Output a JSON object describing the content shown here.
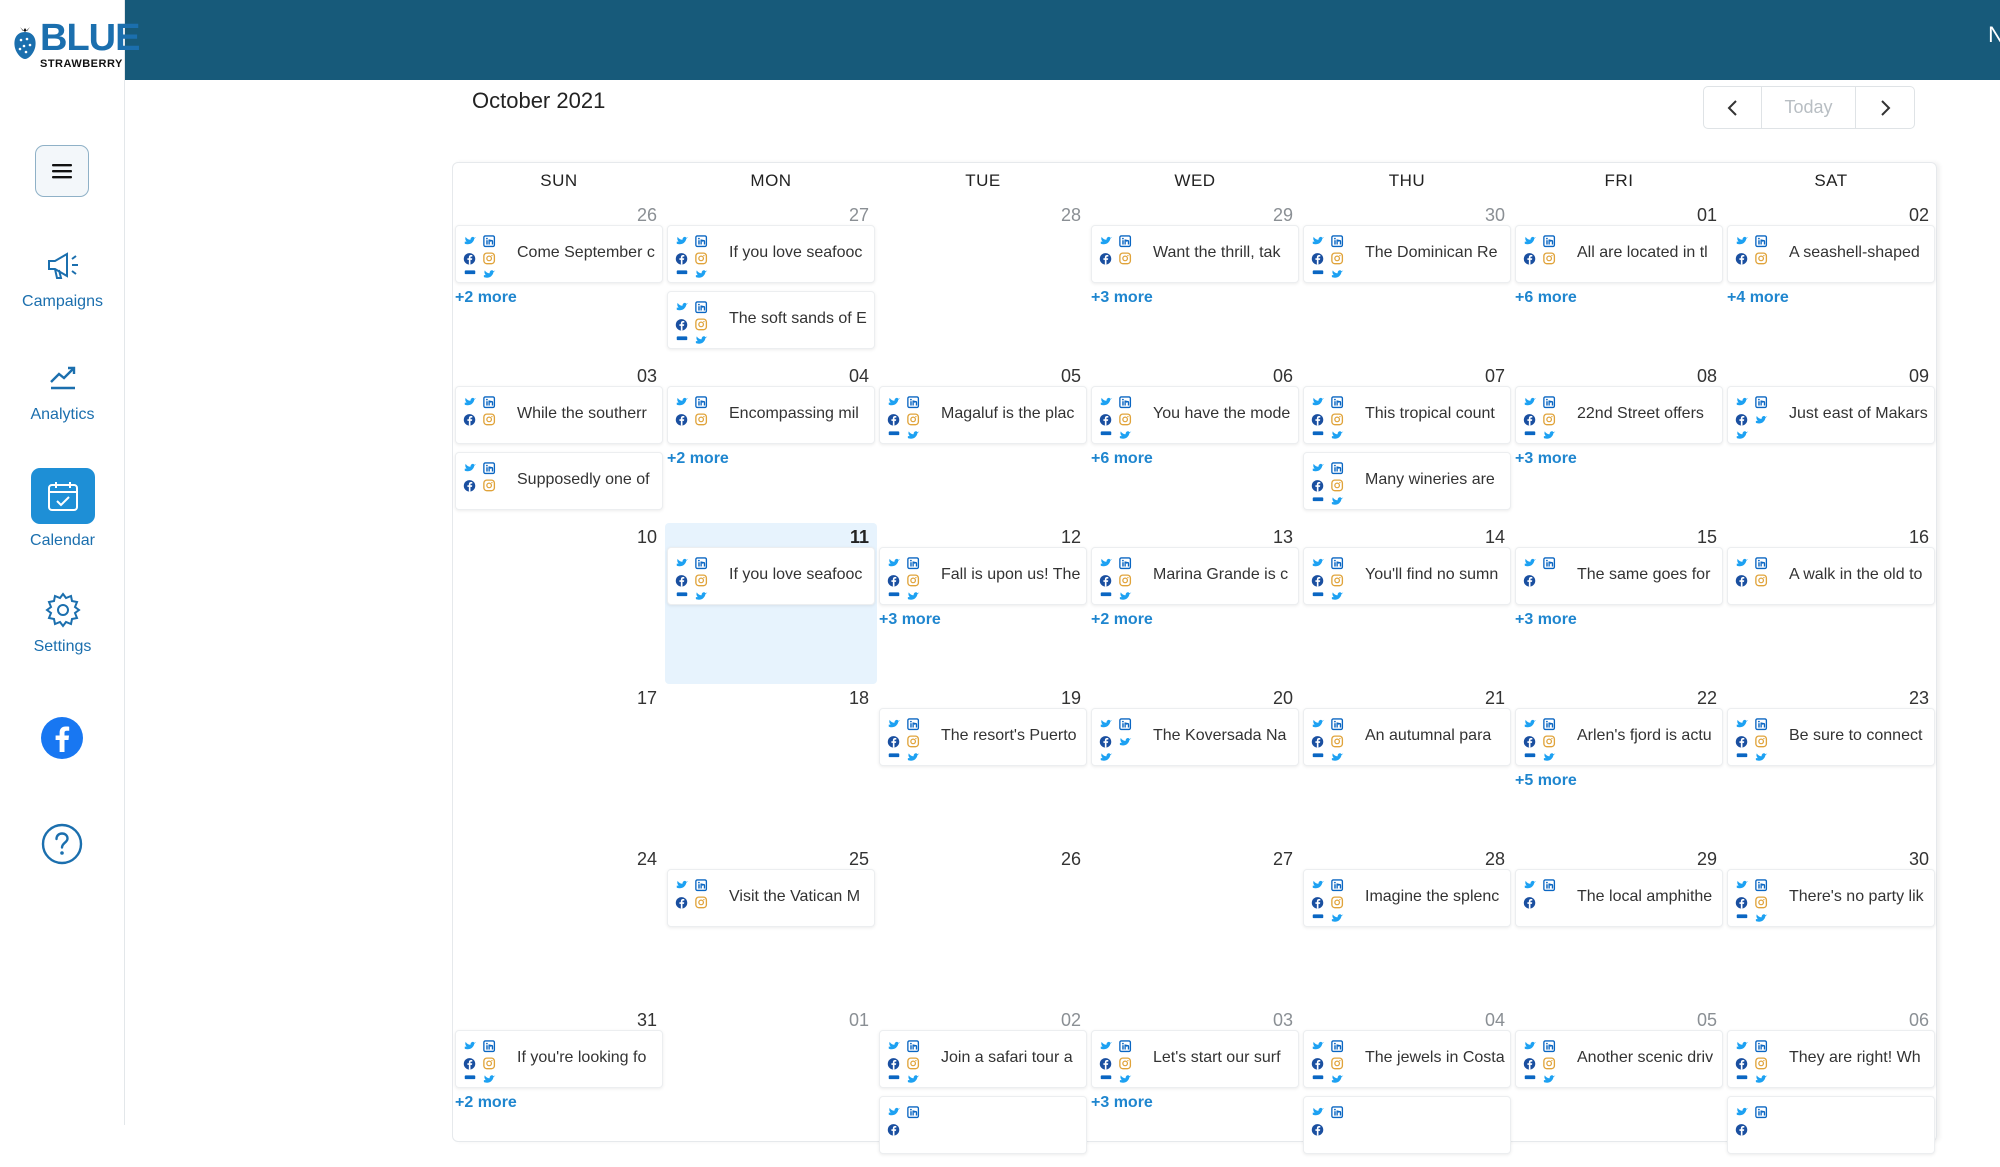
{
  "app": {
    "logo_text": "BLUE",
    "logo_sub": "STRAWBERRY",
    "topbar_edge_char": "N"
  },
  "sidebar": {
    "items": [
      {
        "label": "Campaigns",
        "icon": "megaphone-icon"
      },
      {
        "label": "Analytics",
        "icon": "trend-chart-icon"
      },
      {
        "label": "Calendar",
        "icon": "calendar-check-icon",
        "active": true
      },
      {
        "label": "Settings",
        "icon": "gear-icon"
      }
    ],
    "extra_icons": [
      "facebook-icon",
      "help-icon"
    ]
  },
  "calendar": {
    "title": "October 2021",
    "today_label": "Today",
    "days_of_week": [
      "SUN",
      "MON",
      "TUE",
      "WED",
      "THU",
      "FRI",
      "SAT"
    ],
    "weeks": [
      [
        {
          "num": "26",
          "muted": true,
          "events": [
            {
              "text": "Come September c",
              "icons": "full"
            }
          ],
          "more": "+2 more"
        },
        {
          "num": "27",
          "muted": true,
          "events": [
            {
              "text": "If you love seafooc",
              "icons": "full"
            },
            {
              "text": "The soft sands of E",
              "icons": "full"
            }
          ],
          "more": ""
        },
        {
          "num": "28",
          "muted": true,
          "events": [],
          "more": ""
        },
        {
          "num": "29",
          "muted": true,
          "events": [
            {
              "text": "Want the thrill, tak",
              "icons": "tli"
            }
          ],
          "more": "+3 more"
        },
        {
          "num": "30",
          "muted": true,
          "events": [
            {
              "text": "The Dominican Re",
              "icons": "full"
            }
          ],
          "more": ""
        },
        {
          "num": "01",
          "muted": false,
          "events": [
            {
              "text": "All are located in tl",
              "icons": "tli"
            }
          ],
          "more": "+6 more"
        },
        {
          "num": "02",
          "muted": false,
          "events": [
            {
              "text": "A seashell-shaped",
              "icons": "tli"
            }
          ],
          "more": "+4 more"
        }
      ],
      [
        {
          "num": "03",
          "events": [
            {
              "text": "While the southerr",
              "icons": "tli"
            },
            {
              "text": "Supposedly one of",
              "icons": "tli"
            }
          ],
          "more": ""
        },
        {
          "num": "04",
          "events": [
            {
              "text": "Encompassing mil",
              "icons": "tli"
            }
          ],
          "more": "+2 more"
        },
        {
          "num": "05",
          "events": [
            {
              "text": "Magaluf is the plac",
              "icons": "full"
            }
          ],
          "more": ""
        },
        {
          "num": "06",
          "events": [
            {
              "text": "You have the mode",
              "icons": "full"
            }
          ],
          "more": "+6 more"
        },
        {
          "num": "07",
          "events": [
            {
              "text": "This tropical count",
              "icons": "full"
            },
            {
              "text": "Many wineries are",
              "icons": "full"
            }
          ],
          "more": ""
        },
        {
          "num": "08",
          "events": [
            {
              "text": "22nd Street offers",
              "icons": "full"
            }
          ],
          "more": "+3 more"
        },
        {
          "num": "09",
          "events": [
            {
              "text": "Just east of Makars",
              "icons": "twitter2"
            }
          ],
          "more": ""
        }
      ],
      [
        {
          "num": "10",
          "events": [],
          "more": ""
        },
        {
          "num": "11",
          "today": true,
          "events": [
            {
              "text": "If you love seafooc",
              "icons": "full"
            }
          ],
          "more": ""
        },
        {
          "num": "12",
          "events": [
            {
              "text": "Fall is upon us! The",
              "icons": "full"
            }
          ],
          "more": "+3 more"
        },
        {
          "num": "13",
          "events": [
            {
              "text": "Marina Grande is c",
              "icons": "full"
            }
          ],
          "more": "+2 more"
        },
        {
          "num": "14",
          "events": [
            {
              "text": "You'll find no sumn",
              "icons": "full"
            }
          ],
          "more": ""
        },
        {
          "num": "15",
          "events": [
            {
              "text": "The same goes for",
              "icons": "tl"
            }
          ],
          "more": "+3 more"
        },
        {
          "num": "16",
          "events": [
            {
              "text": "A walk in the old to",
              "icons": "tli"
            }
          ],
          "more": ""
        }
      ],
      [
        {
          "num": "17",
          "events": [],
          "more": ""
        },
        {
          "num": "18",
          "events": [],
          "more": ""
        },
        {
          "num": "19",
          "events": [
            {
              "text": "The resort's Puerto",
              "icons": "full"
            }
          ],
          "more": ""
        },
        {
          "num": "20",
          "events": [
            {
              "text": "The Koversada Na",
              "icons": "twitter2"
            }
          ],
          "more": ""
        },
        {
          "num": "21",
          "events": [
            {
              "text": "An autumnal para",
              "icons": "full"
            }
          ],
          "more": ""
        },
        {
          "num": "22",
          "events": [
            {
              "text": "Arlen's fjord is actu",
              "icons": "full"
            }
          ],
          "more": "+5 more"
        },
        {
          "num": "23",
          "events": [
            {
              "text": "Be sure to connect",
              "icons": "full"
            }
          ],
          "more": ""
        }
      ],
      [
        {
          "num": "24",
          "events": [],
          "more": ""
        },
        {
          "num": "25",
          "events": [
            {
              "text": "Visit the Vatican M",
              "icons": "tli"
            }
          ],
          "more": ""
        },
        {
          "num": "26",
          "events": [],
          "more": ""
        },
        {
          "num": "27",
          "events": [],
          "more": ""
        },
        {
          "num": "28",
          "events": [
            {
              "text": "Imagine the splenc",
              "icons": "full"
            }
          ],
          "more": ""
        },
        {
          "num": "29",
          "events": [
            {
              "text": "The local amphithe",
              "icons": "tl"
            }
          ],
          "more": ""
        },
        {
          "num": "30",
          "events": [
            {
              "text": "There's no party lik",
              "icons": "full"
            }
          ],
          "more": ""
        }
      ],
      [
        {
          "num": "31",
          "events": [
            {
              "text": "If you're looking fo",
              "icons": "full"
            }
          ],
          "more": "+2 more"
        },
        {
          "num": "01",
          "muted": true,
          "events": [],
          "more": ""
        },
        {
          "num": "02",
          "muted": true,
          "events": [
            {
              "text": "Join a safari tour a",
              "icons": "full"
            },
            {
              "text": "",
              "icons": "tl"
            }
          ],
          "more": ""
        },
        {
          "num": "03",
          "muted": true,
          "events": [
            {
              "text": "Let's start our surf",
              "icons": "full"
            }
          ],
          "more": "+3 more"
        },
        {
          "num": "04",
          "muted": true,
          "events": [
            {
              "text": "The jewels in Costa",
              "icons": "full"
            },
            {
              "text": "",
              "icons": "tl"
            }
          ],
          "more": ""
        },
        {
          "num": "05",
          "muted": true,
          "events": [
            {
              "text": "Another scenic driv",
              "icons": "full"
            }
          ],
          "more": ""
        },
        {
          "num": "06",
          "muted": true,
          "events": [
            {
              "text": "They are right! Wh",
              "icons": "full"
            },
            {
              "text": "",
              "icons": "tl"
            }
          ],
          "more": ""
        }
      ]
    ]
  },
  "colors": {
    "topbar": "#175a7a",
    "accent": "#1e8fd6",
    "twitter": "#1da1f2",
    "linkedin": "#0a66c2",
    "facebook": "#1877f2",
    "instagram": "#e0a33a"
  }
}
